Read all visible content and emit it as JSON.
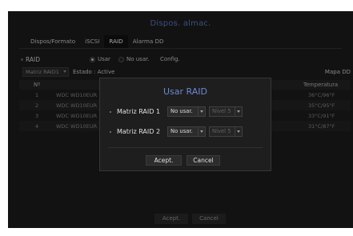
{
  "window": {
    "title": "Dispos. almac."
  },
  "tabs": [
    {
      "label": "Dispos/Formato"
    },
    {
      "label": "iSCSI"
    },
    {
      "label": "RAID"
    },
    {
      "label": "Alarma DD"
    }
  ],
  "raid": {
    "label": "RAID",
    "option_use": "Usar",
    "option_no_use": "No usar.",
    "config": "Config.",
    "selected": "Usar"
  },
  "sub": {
    "matrix_select": "Matriz RAID1",
    "status": "Estado : Active",
    "map_dd": "Mapa DD"
  },
  "table": {
    "headers": {
      "num": "Nº",
      "model": "M",
      "temp": "Temperatura"
    },
    "rows": [
      {
        "num": "1",
        "model": "WDC WD10EUR",
        "temp": "36°C/96°F"
      },
      {
        "num": "2",
        "model": "WDC WD10EUR",
        "temp": "35°C/95°F"
      },
      {
        "num": "3",
        "model": "WDC WD10EUR",
        "temp": "33°C/91°F"
      },
      {
        "num": "4",
        "model": "WDC WD10EUR",
        "temp": "31°C/87°F"
      }
    ]
  },
  "footer": {
    "ok_label": "Acept.",
    "cancel_label": "Cancel"
  },
  "modal": {
    "title": "Usar RAID",
    "rows": [
      {
        "label": "Matriz RAID 1",
        "value": "No usar.",
        "level": "Nivel 5"
      },
      {
        "label": "Matriz RAID 2",
        "value": "No usar.",
        "level": "Nivel 5"
      }
    ],
    "ok_label": "Acept.",
    "cancel_label": "Cancel"
  },
  "colors": {
    "accent": "#5b79c9",
    "background": "#1c1c1c",
    "modal_bg": "#1e1e1e"
  }
}
